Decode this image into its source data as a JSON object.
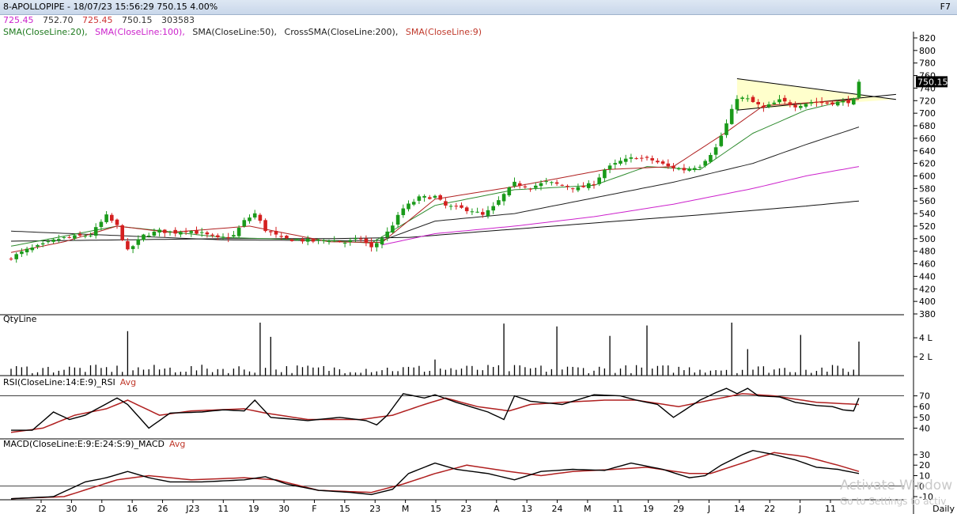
{
  "window": {
    "title": "8-APOLLOPIPE - 18/07/23 15:56:29 750.15 4.00%",
    "shortcut": "F7"
  },
  "ohlc": {
    "open": "725.45",
    "high": "752.70",
    "low": "725.45",
    "close": "750.15",
    "volume": "303583"
  },
  "indicators": [
    {
      "label": "SMA(CloseLine:20),",
      "color": "#1e7a1e"
    },
    {
      "label": "SMA(CloseLine:100),",
      "color": "#cc22cc"
    },
    {
      "label": "SMA(CloseLine:50),",
      "color": "#222222"
    },
    {
      "label": "CrossSMA(CloseLine:200),",
      "color": "#222222"
    },
    {
      "label": "SMA(CloseLine:9)",
      "color": "#c0392b"
    }
  ],
  "colors": {
    "up": "#1a9a1a",
    "down": "#d42020",
    "sma9": "#b02020",
    "sma20": "#2e8b2e",
    "sma50": "#222222",
    "sma100": "#cc22cc",
    "sma200": "#111111",
    "trend": "#000000",
    "trendFill": "#ffffcc"
  },
  "panels": {
    "qty": {
      "label": "QtyLine"
    },
    "rsi": {
      "label": "RSI(CloseLine:14:E:9)_RSI",
      "avg": "Avg"
    },
    "macd": {
      "label": "MACD(CloseLine:E:9:E:24:S:9)_MACD",
      "avg": "Avg"
    }
  },
  "last_price_tag": "750.15",
  "timeframe": "Daily",
  "watermark": {
    "line1": "Activate Window",
    "line2": "Go to Settings to activ"
  },
  "chart_data": {
    "type": "candlestick",
    "price_axis": {
      "ticks": [
        820,
        800,
        780,
        760,
        740,
        720,
        700,
        680,
        660,
        640,
        620,
        600,
        580,
        560,
        540,
        520,
        500,
        480,
        460,
        440,
        420,
        400,
        380
      ],
      "range": [
        380,
        825
      ]
    },
    "x_labels": [
      "22",
      "30",
      "D",
      "16",
      "26",
      "J23",
      "11",
      "19",
      "30",
      "F",
      "15",
      "23",
      "M",
      "15",
      "23",
      "A",
      "13",
      "24",
      "M",
      "11",
      "19",
      "29",
      "J",
      "14",
      "22",
      "J",
      "11"
    ],
    "anchors": [
      [
        0,
        470
      ],
      [
        3,
        482
      ],
      [
        6,
        490
      ],
      [
        9,
        500
      ],
      [
        12,
        503
      ],
      [
        15,
        506
      ],
      [
        18,
        536
      ],
      [
        20,
        520
      ],
      [
        22,
        480
      ],
      [
        25,
        505
      ],
      [
        28,
        512
      ],
      [
        31,
        510
      ],
      [
        33,
        514
      ],
      [
        36,
        508
      ],
      [
        39,
        500
      ],
      [
        42,
        505
      ],
      [
        44,
        528
      ],
      [
        46,
        540
      ],
      [
        48,
        514
      ],
      [
        51,
        500
      ],
      [
        54,
        498
      ],
      [
        57,
        496
      ],
      [
        60,
        498
      ],
      [
        63,
        494
      ],
      [
        66,
        500
      ],
      [
        68,
        485
      ],
      [
        71,
        510
      ],
      [
        74,
        548
      ],
      [
        77,
        565
      ],
      [
        80,
        567
      ],
      [
        82,
        552
      ],
      [
        85,
        548
      ],
      [
        87,
        545
      ],
      [
        89,
        537
      ],
      [
        91,
        550
      ],
      [
        93,
        570
      ],
      [
        95,
        588
      ],
      [
        98,
        582
      ],
      [
        101,
        590
      ],
      [
        104,
        585
      ],
      [
        107,
        580
      ],
      [
        110,
        588
      ],
      [
        112,
        610
      ],
      [
        115,
        623
      ],
      [
        118,
        630
      ],
      [
        121,
        625
      ],
      [
        124,
        615
      ],
      [
        127,
        610
      ],
      [
        130,
        617
      ],
      [
        133,
        645
      ],
      [
        135,
        683
      ],
      [
        137,
        725
      ],
      [
        139,
        722
      ],
      [
        142,
        708
      ],
      [
        145,
        720
      ],
      [
        148,
        712
      ],
      [
        151,
        718
      ],
      [
        154,
        716
      ],
      [
        157,
        718
      ],
      [
        159,
        720
      ],
      [
        160,
        748
      ]
    ],
    "sma20_anchors": [
      [
        0,
        488
      ],
      [
        20,
        520
      ],
      [
        40,
        502
      ],
      [
        60,
        497
      ],
      [
        68,
        493
      ],
      [
        80,
        553
      ],
      [
        95,
        578
      ],
      [
        110,
        585
      ],
      [
        120,
        615
      ],
      [
        130,
        610
      ],
      [
        140,
        668
      ],
      [
        150,
        705
      ],
      [
        160,
        725
      ]
    ],
    "sma9_anchors": [
      [
        0,
        478
      ],
      [
        10,
        495
      ],
      [
        20,
        520
      ],
      [
        30,
        510
      ],
      [
        45,
        520
      ],
      [
        60,
        495
      ],
      [
        70,
        494
      ],
      [
        80,
        563
      ],
      [
        95,
        583
      ],
      [
        112,
        610
      ],
      [
        125,
        615
      ],
      [
        135,
        670
      ],
      [
        142,
        712
      ],
      [
        160,
        722
      ]
    ],
    "sma50_anchors": [
      [
        0,
        512
      ],
      [
        20,
        505
      ],
      [
        40,
        498
      ],
      [
        60,
        497
      ],
      [
        70,
        497
      ],
      [
        80,
        528
      ],
      [
        95,
        540
      ],
      [
        110,
        565
      ],
      [
        125,
        590
      ],
      [
        140,
        620
      ],
      [
        150,
        650
      ],
      [
        160,
        678
      ]
    ],
    "sma100_anchors": [
      [
        70,
        490
      ],
      [
        80,
        508
      ],
      [
        95,
        520
      ],
      [
        110,
        535
      ],
      [
        125,
        555
      ],
      [
        140,
        580
      ],
      [
        150,
        600
      ],
      [
        160,
        615
      ]
    ],
    "sma200_anchors": [
      [
        0,
        496
      ],
      [
        20,
        498
      ],
      [
        40,
        500
      ],
      [
        60,
        500
      ],
      [
        75,
        502
      ],
      [
        90,
        512
      ],
      [
        110,
        525
      ],
      [
        130,
        538
      ],
      [
        150,
        552
      ],
      [
        160,
        560
      ]
    ],
    "trendlines": [
      {
        "from": [
          137,
          755
        ],
        "to": [
          167,
          722
        ]
      },
      {
        "from": [
          137,
          705
        ],
        "to": [
          167,
          730
        ]
      }
    ],
    "qty_axis": {
      "ticks": [
        "4 L",
        "2 L"
      ],
      "values": [
        4,
        2
      ],
      "max": 5.6
    },
    "qty_spikes": [
      [
        22,
        4.7
      ],
      [
        47,
        5.6
      ],
      [
        49,
        4.1
      ],
      [
        80,
        1.7
      ],
      [
        93,
        5.5
      ],
      [
        103,
        5.2
      ],
      [
        113,
        4.2
      ],
      [
        120,
        5.3
      ],
      [
        136,
        5.6
      ],
      [
        139,
        2.8
      ],
      [
        149,
        4.3
      ],
      [
        160,
        3.6
      ]
    ],
    "rsi_axis": {
      "ticks": [
        70,
        60,
        50,
        40
      ],
      "range": [
        30,
        80
      ],
      "level": 70
    },
    "rsi_anchors": [
      [
        0,
        38
      ],
      [
        4,
        38
      ],
      [
        8,
        55
      ],
      [
        11,
        48
      ],
      [
        14,
        52
      ],
      [
        20,
        68
      ],
      [
        22,
        62
      ],
      [
        26,
        40
      ],
      [
        30,
        54
      ],
      [
        36,
        55
      ],
      [
        40,
        57
      ],
      [
        44,
        56
      ],
      [
        46,
        66
      ],
      [
        49,
        50
      ],
      [
        56,
        47
      ],
      [
        62,
        50
      ],
      [
        67,
        47
      ],
      [
        69,
        43
      ],
      [
        71,
        52
      ],
      [
        74,
        72
      ],
      [
        78,
        68
      ],
      [
        80,
        71
      ],
      [
        84,
        64
      ],
      [
        90,
        55
      ],
      [
        93,
        48
      ],
      [
        95,
        70
      ],
      [
        98,
        65
      ],
      [
        104,
        62
      ],
      [
        110,
        71
      ],
      [
        115,
        70
      ],
      [
        118,
        66
      ],
      [
        122,
        62
      ],
      [
        125,
        50
      ],
      [
        130,
        66
      ],
      [
        133,
        73
      ],
      [
        135,
        77
      ],
      [
        137,
        72
      ],
      [
        139,
        77
      ],
      [
        141,
        70
      ],
      [
        145,
        69
      ],
      [
        148,
        64
      ],
      [
        152,
        61
      ],
      [
        155,
        60
      ],
      [
        157,
        57
      ],
      [
        159,
        56
      ],
      [
        160,
        68
      ]
    ],
    "rsi_avg_anchors": [
      [
        0,
        36
      ],
      [
        6,
        40
      ],
      [
        12,
        52
      ],
      [
        18,
        58
      ],
      [
        22,
        66
      ],
      [
        28,
        52
      ],
      [
        34,
        56
      ],
      [
        44,
        58
      ],
      [
        48,
        54
      ],
      [
        56,
        48
      ],
      [
        66,
        48
      ],
      [
        72,
        52
      ],
      [
        78,
        62
      ],
      [
        82,
        68
      ],
      [
        88,
        60
      ],
      [
        94,
        56
      ],
      [
        98,
        62
      ],
      [
        104,
        64
      ],
      [
        112,
        66
      ],
      [
        118,
        66
      ],
      [
        126,
        60
      ],
      [
        132,
        66
      ],
      [
        138,
        72
      ],
      [
        144,
        70
      ],
      [
        152,
        64
      ],
      [
        160,
        62
      ]
    ],
    "macd_axis": {
      "ticks": [
        30,
        20,
        10,
        0,
        -10
      ],
      "range": [
        -13,
        36
      ],
      "zero": 0
    },
    "macd_anchors": [
      [
        0,
        -12
      ],
      [
        8,
        -10
      ],
      [
        14,
        4
      ],
      [
        18,
        8
      ],
      [
        22,
        14
      ],
      [
        26,
        8
      ],
      [
        30,
        4
      ],
      [
        36,
        4
      ],
      [
        44,
        6
      ],
      [
        48,
        9
      ],
      [
        52,
        2
      ],
      [
        58,
        -4
      ],
      [
        64,
        -6
      ],
      [
        68,
        -8
      ],
      [
        72,
        -3
      ],
      [
        75,
        12
      ],
      [
        80,
        22
      ],
      [
        84,
        16
      ],
      [
        90,
        12
      ],
      [
        95,
        6
      ],
      [
        100,
        14
      ],
      [
        106,
        16
      ],
      [
        112,
        15
      ],
      [
        117,
        22
      ],
      [
        123,
        16
      ],
      [
        128,
        8
      ],
      [
        131,
        10
      ],
      [
        134,
        20
      ],
      [
        138,
        30
      ],
      [
        140,
        34
      ],
      [
        144,
        30
      ],
      [
        148,
        25
      ],
      [
        152,
        18
      ],
      [
        156,
        16
      ],
      [
        160,
        12
      ]
    ],
    "macd_avg_anchors": [
      [
        0,
        -12
      ],
      [
        10,
        -10
      ],
      [
        20,
        6
      ],
      [
        26,
        10
      ],
      [
        34,
        6
      ],
      [
        44,
        8
      ],
      [
        50,
        6
      ],
      [
        58,
        -4
      ],
      [
        68,
        -6
      ],
      [
        74,
        2
      ],
      [
        80,
        12
      ],
      [
        86,
        20
      ],
      [
        94,
        14
      ],
      [
        100,
        10
      ],
      [
        106,
        14
      ],
      [
        114,
        16
      ],
      [
        120,
        18
      ],
      [
        128,
        12
      ],
      [
        132,
        12
      ],
      [
        138,
        22
      ],
      [
        144,
        32
      ],
      [
        150,
        28
      ],
      [
        156,
        20
      ],
      [
        160,
        14
      ]
    ]
  }
}
